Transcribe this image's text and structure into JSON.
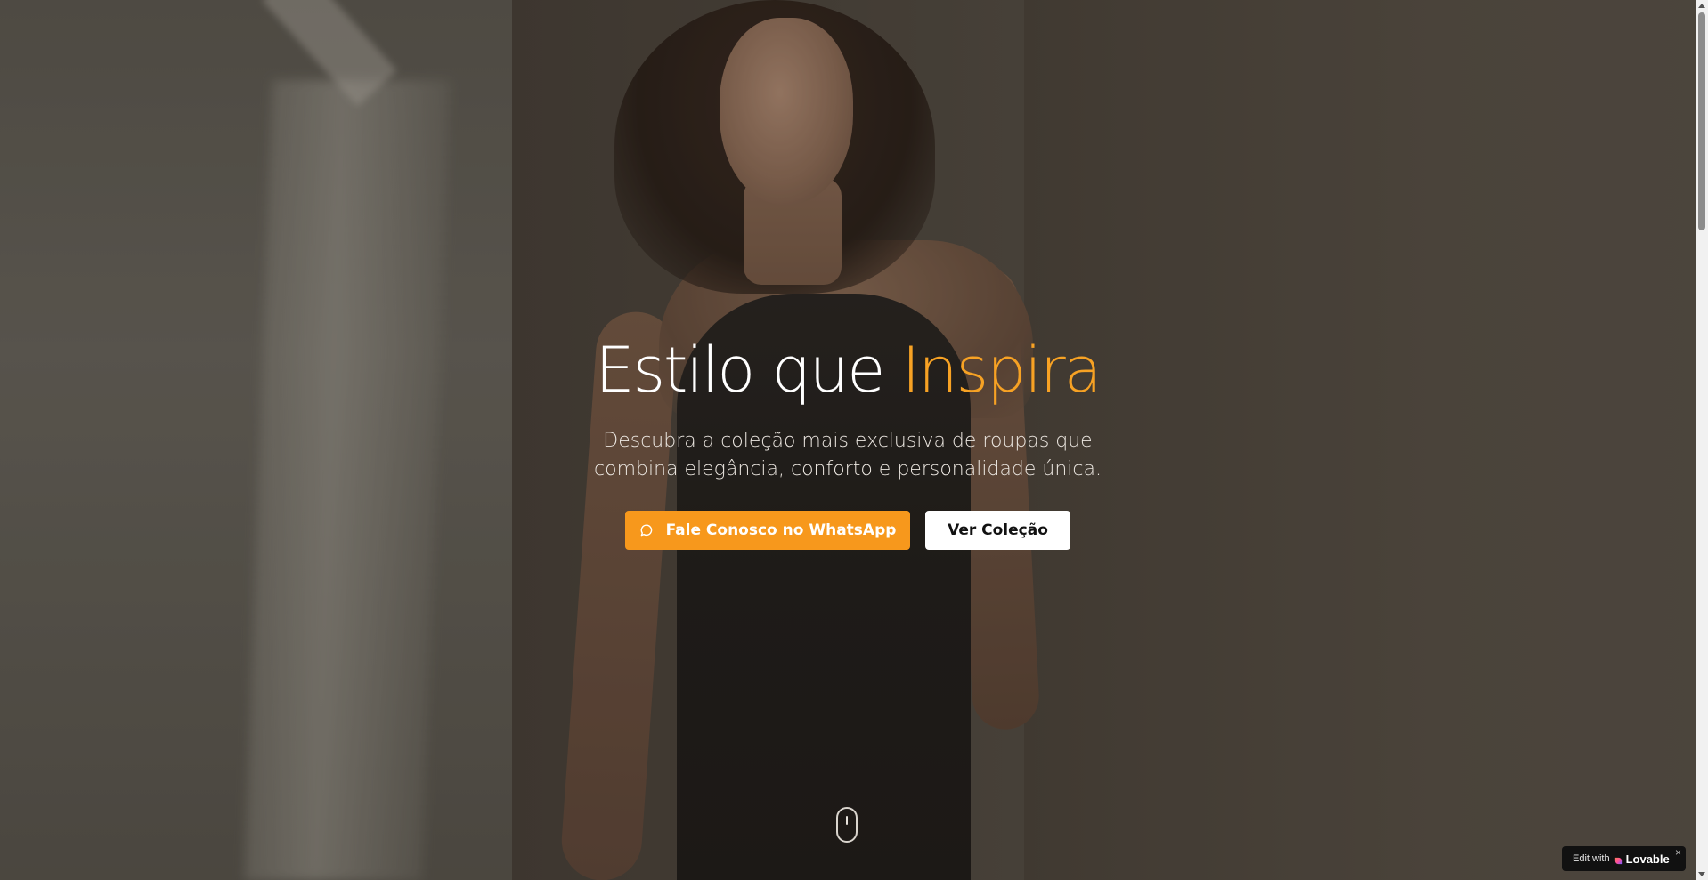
{
  "hero": {
    "title_prefix": "Estilo que ",
    "title_accent": "Inspira",
    "subtitle": "Descubra a coleção mais exclusiva de roupas que combina elegância, conforto e personalidade única.",
    "whatsapp_button_label": "Fale Conosco no WhatsApp",
    "collection_button_label": "Ver Coleção"
  },
  "icons": {
    "whatsapp": "message-circle-icon",
    "scroll": "mouse-scroll-icon",
    "lovable": "heart-icon",
    "close": "close-icon"
  },
  "badge": {
    "edit_text": "Edit with",
    "brand": "Lovable",
    "close_label": "×"
  },
  "colors": {
    "accent": "#f7a224",
    "button_primary": "#f7981c",
    "button_secondary": "#ffffff",
    "badge_bg": "#111111"
  }
}
